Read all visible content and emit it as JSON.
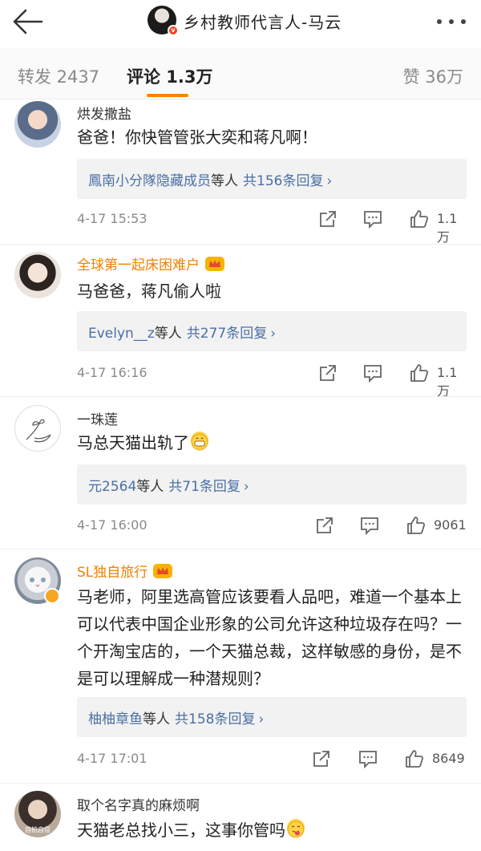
{
  "header": {
    "title": "乡村教师代言人-马云",
    "back_icon": "arrow-left-icon",
    "more_icon": "more-horizontal-icon"
  },
  "tabs": {
    "repost": "转发 2437",
    "comments": "评论 1.3万",
    "likes": "赞 36万",
    "active_color": "#ff8200"
  },
  "comments": [
    {
      "name": "烘发撒盐",
      "vip": false,
      "text": "爸爸！你快管管张大奕和蒋凡啊！",
      "reply_names": "鳳南小分隊隐藏成员",
      "reply_suffix": "等人",
      "reply_count": "共156条回复",
      "time": "4-17 15:53",
      "likes": "1.1万"
    },
    {
      "name": "全球第一起床困难户",
      "vip": true,
      "text": "马爸爸，蒋凡偷人啦",
      "reply_names": "Evelyn__z",
      "reply_suffix": "等人",
      "reply_count": "共277条回复",
      "time": "4-17 16:16",
      "likes": "1.1万"
    },
    {
      "name": "一珠莲",
      "vip": false,
      "text": "马总天猫出轨了",
      "reply_names": "元2564",
      "reply_suffix": "等人",
      "reply_count": "共71条回复",
      "time": "4-17 16:00",
      "likes": "9061"
    },
    {
      "name": "SL独自旅行",
      "vip": true,
      "text": "马老师，阿里选高管应该要看人品吧，难道一个基本上可以代表中国企业形象的公司允许这种垃圾存在吗？一个开淘宝店的，一个天猫总裁，这样敏感的身份，是不是可以理解成一种潜规则？",
      "reply_names": "柚柚章鱼",
      "reply_suffix": "等人",
      "reply_count": "共158条回复",
      "time": "4-17 17:01",
      "likes": "8649"
    },
    {
      "name": "取个名字真的麻烦啊",
      "vip": false,
      "text": "天猫老总找小三，这事你管吗"
    }
  ],
  "avatar_text_5": "自拍自信",
  "link_color": "#4a6fa5",
  "vip_name_color": "#f08000",
  "reply_chevron": "›"
}
